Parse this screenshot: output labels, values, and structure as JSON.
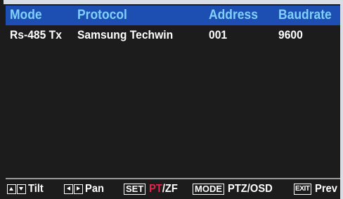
{
  "colors": {
    "header_bg": "#1d4fb3",
    "header_text": "#7fd0ff",
    "row_text": "#ffffff",
    "highlight": "#e5234b",
    "background": "#1c1c1c"
  },
  "table": {
    "headers": {
      "mode": "Mode",
      "protocol": "Protocol",
      "address": "Address",
      "baudrate": "Baudrate"
    },
    "row": {
      "mode": "Rs-485 Tx",
      "protocol": "Samsung Techwin",
      "address": "001",
      "baudrate": "9600"
    }
  },
  "footer": {
    "tilt": {
      "icons": [
        "arrow-up-key-icon",
        "arrow-down-key-icon"
      ],
      "label": "Tilt"
    },
    "pan": {
      "icons": [
        "arrow-left-key-icon",
        "arrow-right-key-icon"
      ],
      "label": "Pan"
    },
    "set": {
      "key": "SET",
      "label_highlight": "PT",
      "label_rest": "/ZF"
    },
    "mode": {
      "key": "MODE",
      "label": "PTZ/OSD"
    },
    "exit": {
      "key": "EXIT",
      "label": "Prev"
    }
  }
}
